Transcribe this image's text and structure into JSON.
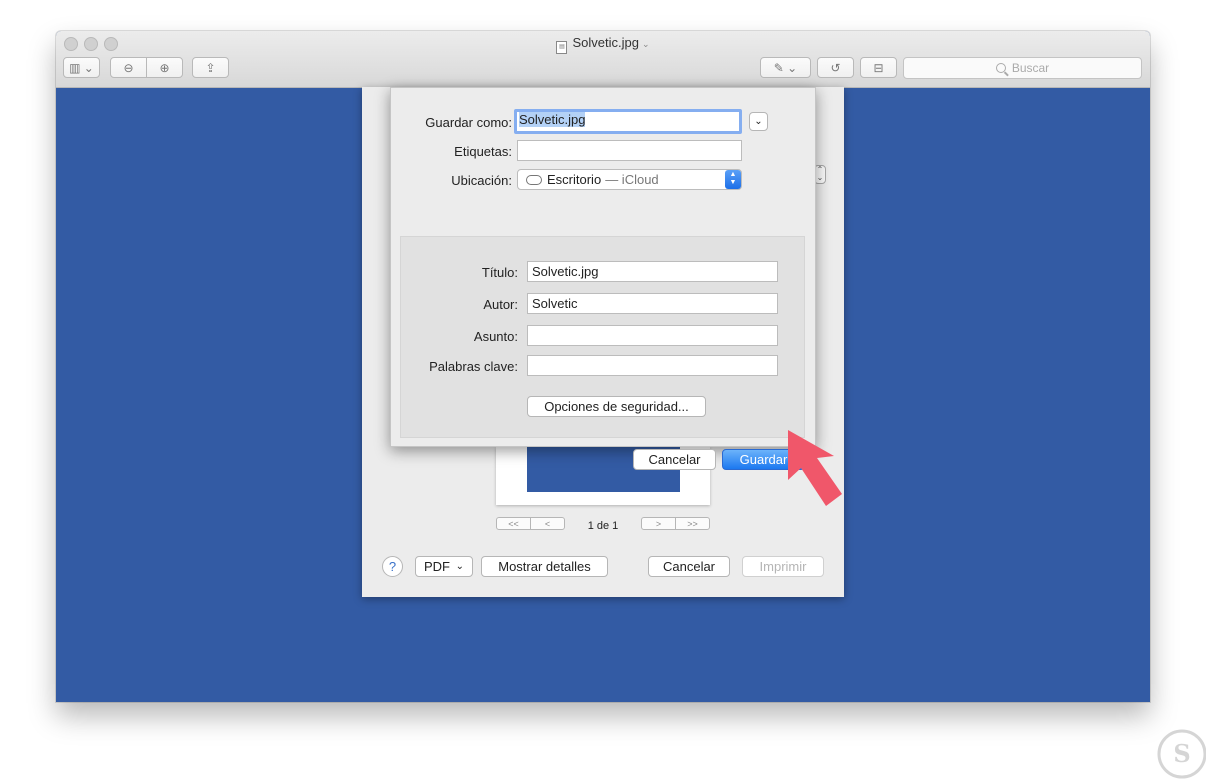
{
  "window": {
    "title": "Solvetic.jpg",
    "search_placeholder": "Buscar",
    "colors": {
      "canvas": "#335ba4",
      "accent": "#1c78f0",
      "arrow": "#f0576a"
    }
  },
  "print_panel": {
    "page_indicator": "1 de 1",
    "help_label": "?",
    "pdf_label": "PDF",
    "details_label": "Mostrar detalles",
    "cancel_label": "Cancelar",
    "print_label": "Imprimir"
  },
  "save_sheet": {
    "save_as_label": "Guardar como:",
    "save_as_value": "Solvetic.jpg",
    "tags_label": "Etiquetas:",
    "tags_value": "",
    "location_label": "Ubicación:",
    "location_value": "Escritorio",
    "location_detail": "— iCloud",
    "title_label": "Título:",
    "title_value": "Solvetic.jpg",
    "author_label": "Autor:",
    "author_value": "Solvetic",
    "subject_label": "Asunto:",
    "subject_value": "",
    "keywords_label": "Palabras clave:",
    "keywords_value": "",
    "security_label": "Opciones de seguridad...",
    "cancel_label": "Cancelar",
    "save_label": "Guardar"
  },
  "icons": [
    "sidebar-icon",
    "zoom-out-icon",
    "zoom-in-icon",
    "share-icon",
    "markup-pen-icon",
    "rotate-icon",
    "toolbox-icon",
    "search-icon",
    "cloud-icon",
    "pointer-arrow-icon",
    "solvetic-logo"
  ]
}
